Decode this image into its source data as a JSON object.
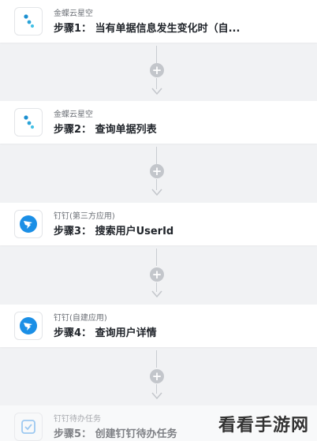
{
  "steps": [
    {
      "app": "金蝶云星空",
      "title": "步骤1： 当有单据信息发生变化时（自...",
      "icon": "kingdee-icon"
    },
    {
      "app": "金蝶云星空",
      "title": "步骤2： 查询单据列表",
      "icon": "kingdee-icon"
    },
    {
      "app": "钉钉(第三方应用)",
      "title": "步骤3： 搜索用户UserId",
      "icon": "dingtalk-icon"
    },
    {
      "app": "钉钉(自建应用)",
      "title": "步骤4： 查询用户详情",
      "icon": "dingtalk-icon"
    },
    {
      "app": "钉钉待办任务",
      "title": "步骤5： 创建钉钉待办任务",
      "icon": "todo-check-icon"
    }
  ],
  "add_step_symbol": "+",
  "watermark": "看看手游网",
  "colors": {
    "kingdee": "#2aa3d8",
    "dingtalk": "#1b8fe6",
    "todo": "#5aa9f0"
  }
}
